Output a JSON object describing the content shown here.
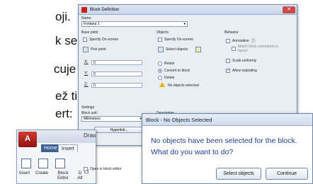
{
  "slide": {
    "lines": [
      "oji.",
      "k se",
      "cuje u",
      "ež tipkom",
      "ert:"
    ]
  },
  "block_definition": {
    "title": "Block Definition",
    "name_label": "Name:",
    "name_value": "Fontana 1",
    "base_point": {
      "heading": "Base point",
      "specify_on_screen": "Specify On-screen",
      "pick_point": "Pick point",
      "x_label": "X:",
      "x_value": "0",
      "y_label": "Y:",
      "y_value": "0",
      "z_label": "Z:",
      "z_value": "0"
    },
    "objects": {
      "heading": "Objects",
      "specify_on_screen": "Specify On-screen",
      "select_objects": "Select objects",
      "retain": "Retain",
      "convert_to_block": "Convert to block",
      "delete": "Delete",
      "status": "No objects selected"
    },
    "behavior": {
      "heading": "Behavior",
      "annotative": "Annotative",
      "match_orientation": "Match block orientation to layout",
      "scale_uniformly": "Scale uniformly",
      "allow_exploding": "Allow exploding"
    },
    "settings": {
      "heading": "Settings",
      "block_unit_label": "Block unit:",
      "block_unit_value": "Millimeters",
      "hyperlink": "Hyperlink..."
    },
    "description_label": "Description",
    "open_in_block_editor": "Open in block editor"
  },
  "ribbon": {
    "app_title": "Draw",
    "tabs": [
      "Home",
      "Insert"
    ],
    "tools": [
      "Insert",
      "Create",
      "Block Editor",
      "D Att"
    ]
  },
  "no_objects_dialog": {
    "title": "Block - No Objects Selected",
    "message": "No objects have been selected for the block. What do you want to do?",
    "select_objects_button": "Select objects",
    "continue_button": "Continue"
  }
}
